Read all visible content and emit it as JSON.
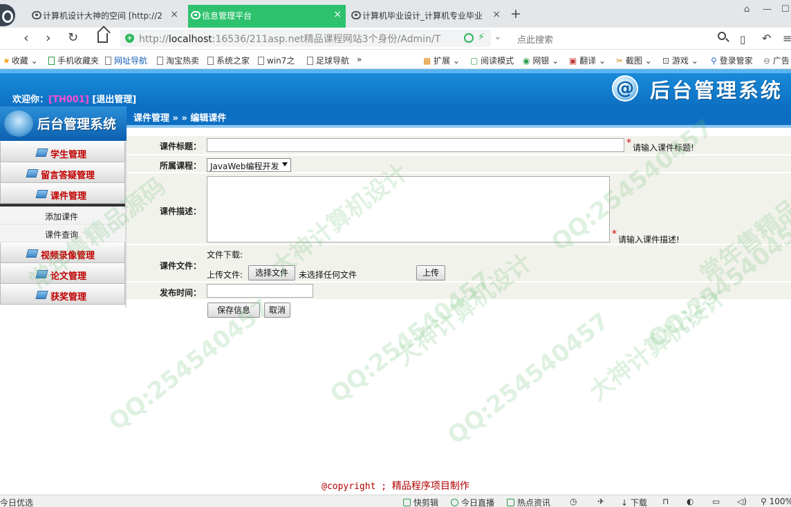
{
  "browser": {
    "tabs": [
      {
        "title": "计算机设计大神的空间 [http://2"
      },
      {
        "title": "信息管理平台"
      },
      {
        "title": "计算机毕业设计_计算机专业毕业"
      }
    ],
    "url_prefix": "http://",
    "url_host": "localhost",
    "url_rest": ":16536/211asp.net精品课程网站3个身份/Admin/T",
    "search_placeholder": "点此搜索",
    "bookmarks": [
      "收藏",
      "手机收藏夹",
      "网址导航",
      "淘宝热卖",
      "系统之家",
      "win7之",
      "足球导航",
      "»"
    ],
    "extensions": [
      "扩展",
      "阅读模式",
      "网银",
      "翻译",
      "截图",
      "游戏",
      "登录管家",
      "广告"
    ]
  },
  "header": {
    "welcome_prefix": "欢迎你：",
    "username": "[TH001]",
    "logout": "[退出管理]",
    "logo_text": "后台管理系统",
    "breadcrumb": "课件管理 » » 编辑课件"
  },
  "sidebar": {
    "logo_text": "后台管理系统",
    "items": [
      {
        "label": "学生管理"
      },
      {
        "label": "留言答疑管理"
      },
      {
        "label": "课件管理"
      },
      {
        "label": "视频录像管理"
      },
      {
        "label": "论文管理"
      },
      {
        "label": "获奖管理"
      }
    ],
    "subitems": [
      {
        "label": "添加课件"
      },
      {
        "label": "课件查询"
      }
    ]
  },
  "form": {
    "title_label": "课件标题：",
    "title_value": "",
    "title_hint": "请输入课件标题!",
    "course_label": "所属课程：",
    "course_selected": "JavaWeb编程开发",
    "desc_label": "课件描述：",
    "desc_hint": "请输入课件描述!",
    "file_label": "课件文件：",
    "file_download_label": "文件下载:",
    "upload_label": "上传文件:",
    "choose_file": "选择文件",
    "no_file": "未选择任何文件",
    "upload_button": "上传",
    "date_label": "发布时间：",
    "date_value": "",
    "save_button": "保存信息",
    "cancel_button": "取消",
    "required_mark": "*"
  },
  "footer": {
    "copyright": "@copyright ; ",
    "copyright_text": "精品程序项目制作"
  },
  "statusbar": {
    "left": "今日优选",
    "items": [
      "快剪辑",
      "今日直播",
      "热点资讯",
      "下载",
      "100%"
    ]
  },
  "watermark": {
    "qq": "QQ:254540457",
    "phrase1": "常年售精品源码",
    "phrase2": "大神计算机设计"
  }
}
